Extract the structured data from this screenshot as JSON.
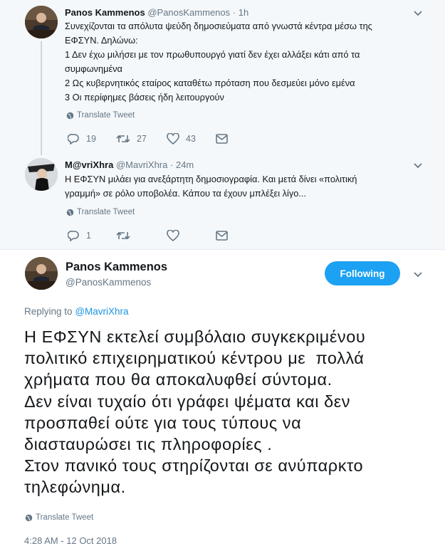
{
  "colors": {
    "thread_bg": "#f5f8fa",
    "accent": "#1da1f2",
    "link": "#1b95e0",
    "muted": "#657786"
  },
  "tweet1": {
    "name": "Panos Kammenos",
    "handle": "@PanosKammenos",
    "dot": "·",
    "time": "1h",
    "lines": [
      "Συνεχίζονται τα απόλυτα ψεύδη δημοσιεύματα από γνωστά κέντρα μέσω της",
      "ΕΦΣΥΝ. Δηλώνω:",
      "1 Δεν έχω μιλήσει με τον πρωθυπουργό γιατί δεν έχει αλλάξει κάτι από τα",
      "συμφωνημένα",
      "2 Ως κυβερνητικός εταίρος καταθέτω πρόταση που δεσμεύει μόνο εμένα",
      "3 Οι περίφημες βάσεις ήδη λειτουργούν"
    ],
    "translate": "Translate Tweet",
    "replies": "19",
    "retweets": "27",
    "likes": "43"
  },
  "tweet2": {
    "name": "M@vriXhra",
    "handle": "@MavriXhra",
    "dot": "·",
    "time": "24m",
    "lines": [
      "Η ΕΦΣΥΝ μιλάει για ανεξάρτητη δημοσιογραφία. Και μετά δίνει «πολιτική",
      "γραμμή» σε ρόλο υποβολέα. Κάπου τα έχουν μπλέξει λίγο..."
    ],
    "translate": "Translate Tweet",
    "replies": "1",
    "retweets": "",
    "likes": ""
  },
  "main": {
    "name": "Panos Kammenos",
    "handle": "@PanosKammenos",
    "follow_label": "Following",
    "replying_prefix": "Replying to",
    "replying_to": "@MavriXhra",
    "lines": [
      "Η ΕΦΣΥΝ εκτελεί συμβόλαιο συγκεκριμένου",
      "πολιτικό επιχειρηματικού κέντρου με  πολλά",
      "χρήματα που θα αποκαλυφθεί σύντομα.",
      "Δεν είναι τυχαίο ότι γράφει ψέματα και δεν",
      "προσπαθεί ούτε για τους τύπους να",
      "διασταυρώσει τις πληροφορίες .",
      "Στον πανικό τους στηρίζονται σε ανύπαρκτο",
      "τηλεφώνημα."
    ],
    "translate": "Translate Tweet",
    "timestamp": "4:28 AM - 12 Oct 2018"
  }
}
